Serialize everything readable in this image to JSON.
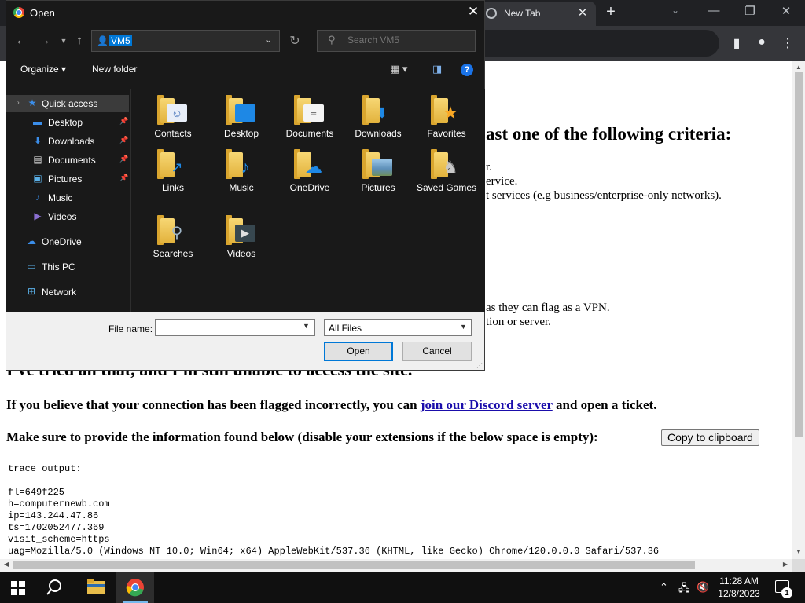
{
  "browser": {
    "tab_title": "New Tab",
    "tab_close": "✕",
    "new_tab": "+",
    "tab_search": "⌄",
    "minimize": "—",
    "maximize": "❐",
    "close": "✕"
  },
  "webpage": {
    "heading_criteria": "ast one of the following criteria:",
    "line_r": "r.",
    "line_service": "ervice.",
    "line_services": "t services (e.g business/enterprise-only networks).",
    "line_vpn": "as they can flag as a VPN.",
    "line_server": "tion or server.",
    "heading_tried": "I've tried all that, and I'm still unable to access the site.",
    "believe_text": "If you believe that your connection has been flagged incorrectly, you can",
    "discord_link": "join our Discord server",
    "ticket_text": "and open a ticket.",
    "provide_text": "Make sure to provide the information found below (disable your extensions if the below space is empty):",
    "copy_button": "Copy to clipboard",
    "trace_header": "trace output:",
    "trace_lines": [
      "fl=649f225",
      "h=computernewb.com",
      "ip=143.244.47.86",
      "ts=1702052477.369",
      "visit_scheme=https",
      "uag=Mozilla/5.0 (Windows NT 10.0; Win64; x64) AppleWebKit/537.36 (KHTML, like Gecko) Chrome/120.0.0.0 Safari/537.36"
    ]
  },
  "dialog": {
    "title": "Open",
    "close": "✕",
    "address": "VM5",
    "search_placeholder": "Search VM5",
    "toolbar": {
      "organize": "Organize",
      "new_folder": "New folder"
    },
    "nav_items": [
      {
        "label": "Quick access",
        "icon": "star-icon",
        "pinned": false
      },
      {
        "label": "Desktop",
        "icon": "desktop-icon",
        "pinned": true
      },
      {
        "label": "Downloads",
        "icon": "download-icon",
        "pinned": true
      },
      {
        "label": "Documents",
        "icon": "documents-icon",
        "pinned": true
      },
      {
        "label": "Pictures",
        "icon": "pictures-icon",
        "pinned": true
      },
      {
        "label": "Music",
        "icon": "music-icon",
        "pinned": false
      },
      {
        "label": "Videos",
        "icon": "videos-icon",
        "pinned": false
      },
      {
        "label": "OneDrive",
        "icon": "onedrive-icon",
        "pinned": false
      },
      {
        "label": "This PC",
        "icon": "computer-icon",
        "pinned": false
      },
      {
        "label": "Network",
        "icon": "network-icon",
        "pinned": false
      }
    ],
    "files": [
      {
        "label": "Contacts",
        "icon": "contacts-folder-icon"
      },
      {
        "label": "Desktop",
        "icon": "desktop-folder-icon"
      },
      {
        "label": "Documents",
        "icon": "documents-folder-icon"
      },
      {
        "label": "Downloads",
        "icon": "downloads-folder-icon"
      },
      {
        "label": "Favorites",
        "icon": "favorites-folder-icon"
      },
      {
        "label": "Links",
        "icon": "links-folder-icon"
      },
      {
        "label": "Music",
        "icon": "music-folder-icon"
      },
      {
        "label": "OneDrive",
        "icon": "onedrive-folder-icon"
      },
      {
        "label": "Pictures",
        "icon": "pictures-folder-icon"
      },
      {
        "label": "Saved Games",
        "icon": "saved-games-folder-icon"
      },
      {
        "label": "Searches",
        "icon": "searches-folder-icon"
      },
      {
        "label": "Videos",
        "icon": "videos-folder-icon"
      }
    ],
    "file_name_label": "File name:",
    "file_name_value": "",
    "file_type": "All Files",
    "open_button": "Open",
    "cancel_button": "Cancel"
  },
  "taskbar": {
    "time": "11:28 AM",
    "date": "12/8/2023",
    "notification_count": "1"
  },
  "colors": {
    "accent": "#0078d7",
    "dialog_bg": "#191919",
    "folder": "#e8bd4a"
  }
}
